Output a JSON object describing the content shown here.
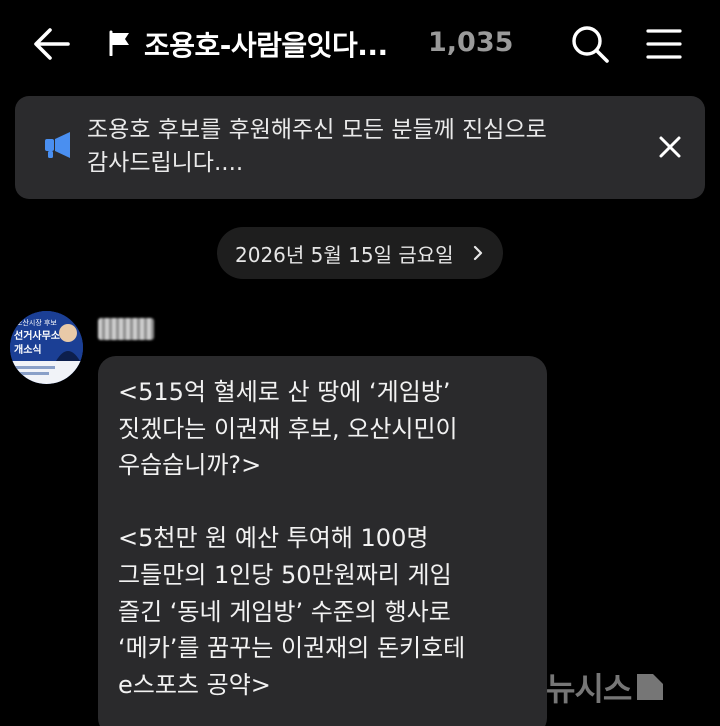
{
  "header": {
    "title": "조용호-사람을잇다...",
    "member_count": "1,035",
    "icons": [
      "back-arrow-icon",
      "flag-icon",
      "search-icon",
      "menu-icon"
    ]
  },
  "notice": {
    "text": "조용호 후보를 후원해주신 모든 분들께 진심으로\n감사드립니다....",
    "icon": "megaphone-icon",
    "accent_color": "#4a8ff0"
  },
  "date_divider": {
    "label": "2026년 5월 15일 금요일"
  },
  "message": {
    "avatar_lines": [
      "오산시장 후보",
      "선거사무소",
      "개소식"
    ],
    "text": "<515억 혈세로 산 땅에 ‘게임방’\n짓겠다는 이권재 후보, 오산시민이\n우습습니까?>\n\n<5천만 원 예산 투여해 100명\n그들만의 1인당 50만원짜리 게임\n즐긴 ‘동네 게임방’ 수준의 행사로\n‘메카’를 꿈꾸는 이권재의 돈키호테\ne스포츠 공약>"
  },
  "watermark": {
    "text": "뉴시스"
  },
  "colors": {
    "background": "#000000",
    "panel": "#2b2b2d",
    "bubble": "#2a2a2c",
    "count_gray": "#9a9a9a"
  }
}
